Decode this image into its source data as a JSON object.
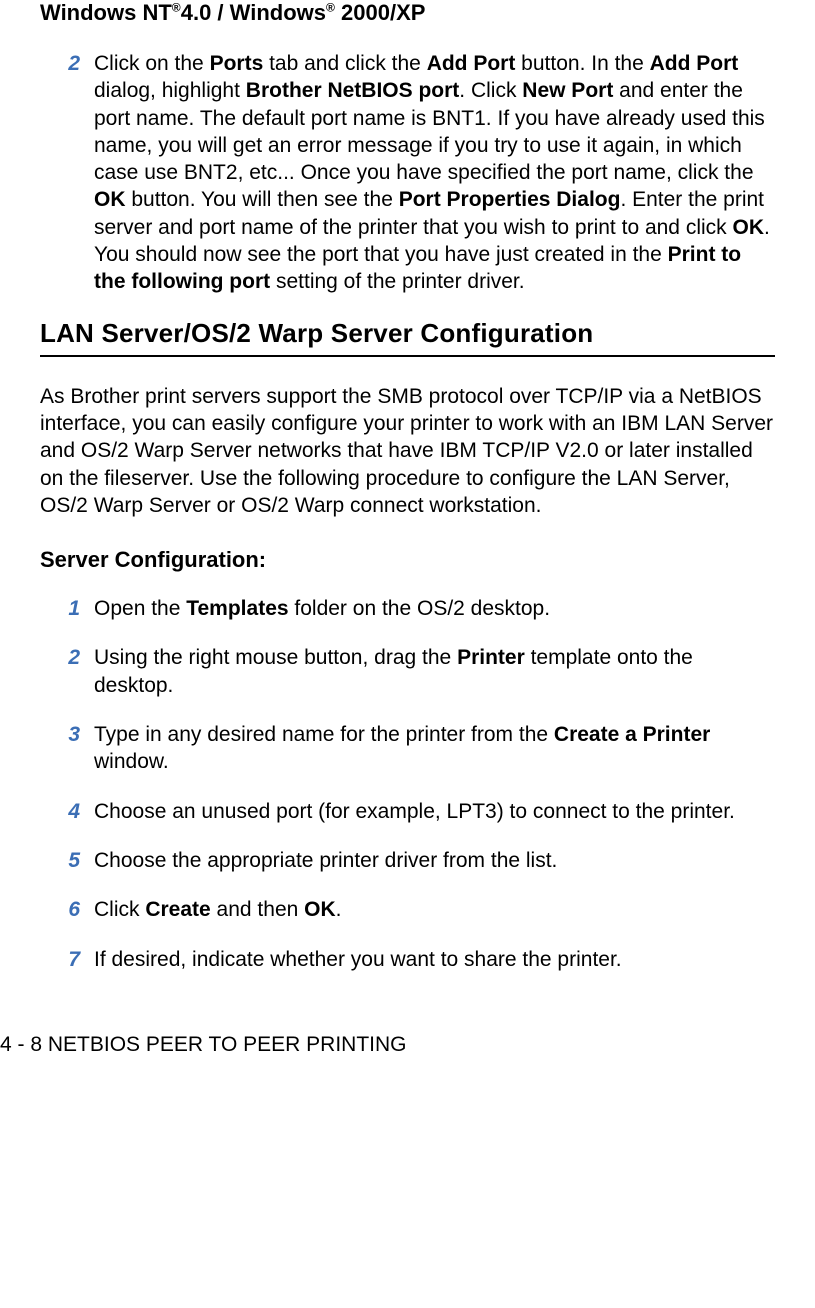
{
  "winHeading": {
    "pre": "Windows NT",
    "reg1": "®",
    "mid": "4.0 / Windows",
    "reg2": "®",
    "post": " 2000/XP"
  },
  "step2": {
    "num": "2",
    "t1": "Click on the ",
    "b1": "Ports",
    "t2": " tab and click the ",
    "b2": "Add Port",
    "t3": " button. In the ",
    "b3": "Add Port",
    "t4": " dialog, highlight ",
    "b4": "Brother NetBIOS port",
    "t5": ". Click ",
    "b5": "New Port",
    "t6": " and enter the port name. The default port name is BNT1. If you have already used this name, you will get an error message if you try to use it again, in which case use BNT2, etc... Once you have specified the port name, click the ",
    "b6": "OK",
    "t7": " button. You will then see the ",
    "b7": "Port Properties Dialog",
    "t8": ". Enter the print server and port name of the printer that you wish to print to and click ",
    "b8": "OK",
    "t9": ". You should now see the port that you have just created in the ",
    "b9": "Print to the following port",
    "t10": " setting of the printer driver."
  },
  "lanHeading": "LAN Server/OS/2 Warp Server Configuration",
  "lanPara": "As Brother print servers support the SMB protocol over TCP/IP via a NetBIOS interface, you can easily configure your printer to work with an IBM LAN Server and OS/2 Warp Server networks that have IBM TCP/IP V2.0 or later installed on the fileserver. Use the following procedure to configure the LAN Server, OS/2 Warp Server or OS/2 Warp connect workstation.",
  "serverConfigHeading": "Server Configuration:",
  "steps": [
    {
      "num": "1",
      "pre": "Open the ",
      "b": "Templates",
      "post": " folder on the OS/2 desktop."
    },
    {
      "num": "2",
      "pre": "Using the right mouse button, drag the ",
      "b": "Printer",
      "post": " template onto the desktop."
    },
    {
      "num": "3",
      "pre": "Type in any desired name for the printer from the ",
      "b": "Create a Printer",
      "post": " window."
    },
    {
      "num": "4",
      "pre": "Choose an unused port (for example, LPT3) to connect to the printer.",
      "b": "",
      "post": ""
    },
    {
      "num": "5",
      "pre": "Choose the appropriate printer driver from the list.",
      "b": "",
      "post": ""
    },
    {
      "num": "6",
      "pre": "Click ",
      "b": "Create",
      "mid": " and then ",
      "b2": "OK",
      "post": "."
    },
    {
      "num": "7",
      "pre": "If desired, indicate whether you want to share the printer.",
      "b": "",
      "post": ""
    }
  ],
  "footer": "4 - 8 NETBIOS PEER TO PEER PRINTING"
}
